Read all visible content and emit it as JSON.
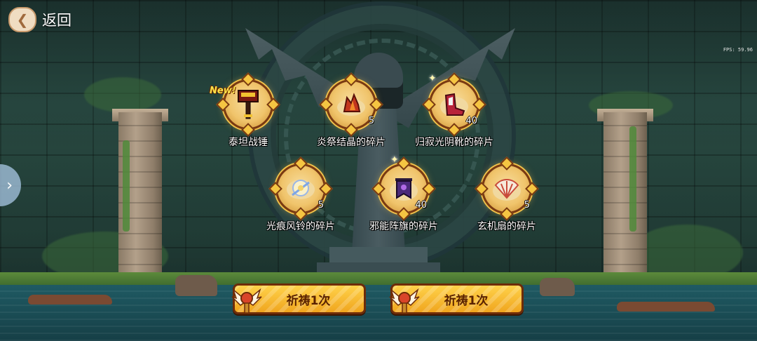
{
  "header": {
    "back_label": "返回"
  },
  "fps_text": "FPS: 59.96",
  "items": [
    {
      "id": "titan-hammer",
      "label": "泰坦战锤",
      "count": "",
      "new_label": "New!",
      "icon": "hammer-icon",
      "color": "#8a1a12"
    },
    {
      "id": "flame-crystal",
      "label": "炎祭结晶的碎片",
      "count": "5",
      "new_label": "",
      "icon": "crystal-icon",
      "color": "#c2361e"
    },
    {
      "id": "silent-boots",
      "label": "归寂光阴靴的碎片",
      "count": "40",
      "new_label": "",
      "icon": "boots-icon",
      "color": "#b8243a"
    },
    {
      "id": "wind-chime",
      "label": "光痕风铃的碎片",
      "count": "5",
      "new_label": "",
      "icon": "chime-icon",
      "color": "#f2e0a8"
    },
    {
      "id": "evil-banner",
      "label": "邪能阵旗的碎片",
      "count": "40",
      "new_label": "",
      "icon": "banner-icon",
      "color": "#4a2a7a"
    },
    {
      "id": "mystic-fan",
      "label": "玄机扇的碎片",
      "count": "5",
      "new_label": "",
      "icon": "fan-icon",
      "color": "#c94a3a"
    }
  ],
  "pray_buttons": [
    {
      "label": "祈祷1次"
    },
    {
      "label": "祈祷1次"
    }
  ],
  "colors": {
    "accent": "#f5c542",
    "badge_rim": "#7a3a12",
    "button_text": "#5a2200"
  }
}
